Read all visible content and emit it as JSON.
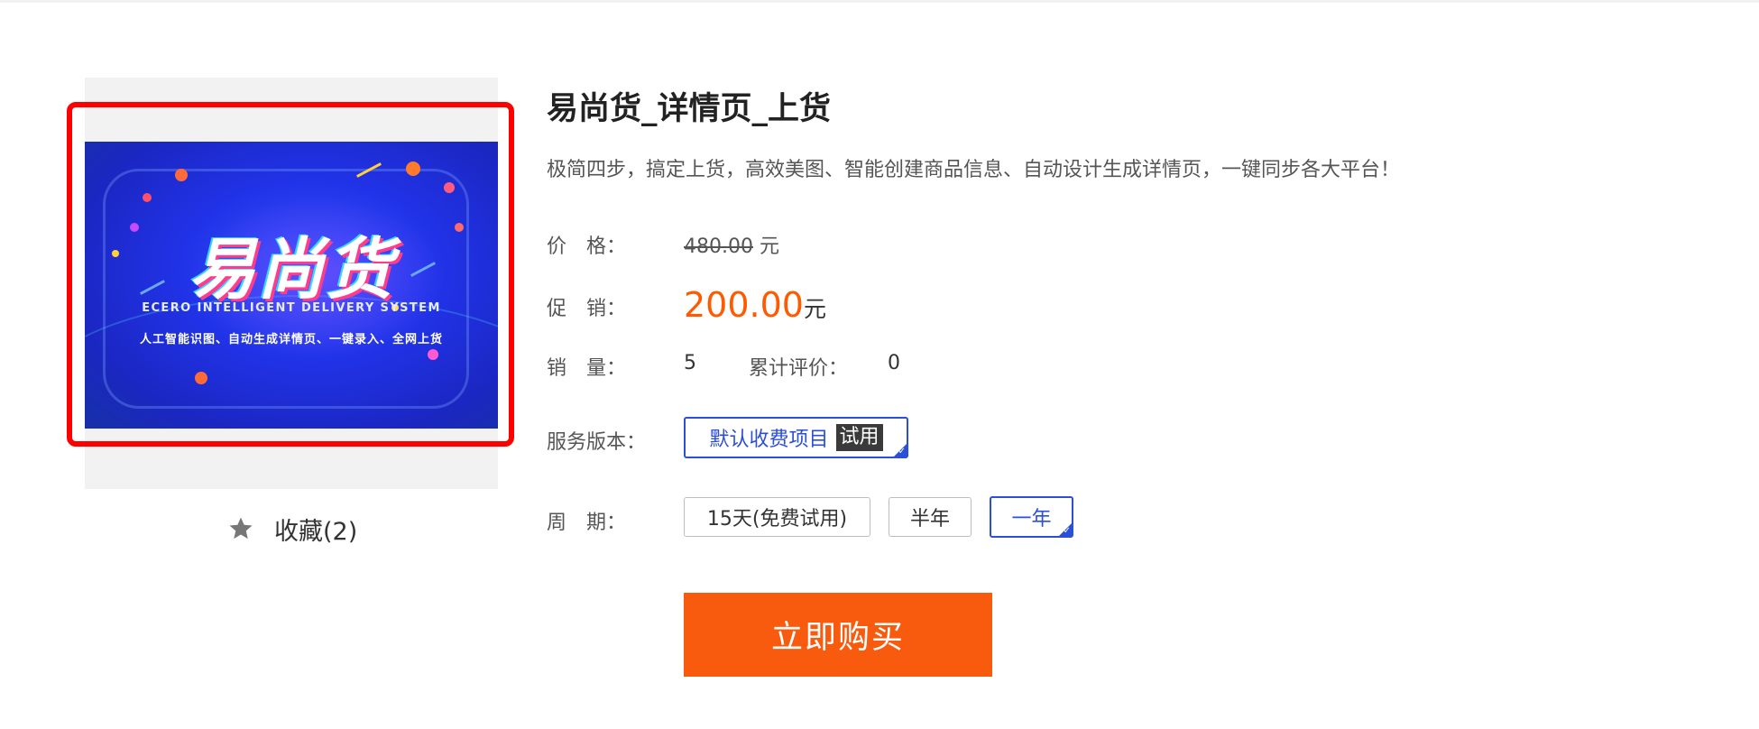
{
  "product": {
    "name": "易尚货_详情页_上货",
    "description": "极简四步，搞定上货，高效美图、智能创建商品信息、自动设计生成详情页，一键同步各大平台！"
  },
  "banner": {
    "brand_text": "易尚货",
    "english_subtitle": "ECERO INTELLIGENT DELIVERY SYSTEM",
    "tagline": "人工智能识图、自动生成详情页、一键录入、全网上货"
  },
  "favorite": {
    "label": "收藏(2)",
    "icon": "star-icon"
  },
  "price": {
    "label": "价　格：",
    "original_value": "480.00",
    "original_unit": "元",
    "promo_label": "促　销：",
    "promo_value": "200.00",
    "promo_unit": "元"
  },
  "stats": {
    "sales_label": "销　量：",
    "sales_value": "5",
    "reviews_label": "累计评价：",
    "reviews_value": "0"
  },
  "service": {
    "label": "服务版本：",
    "options": [
      {
        "label": "默认收费项目",
        "badge": "试用",
        "selected": true
      }
    ]
  },
  "period": {
    "label": "周　期：",
    "options": [
      {
        "label": "15天(免费试用)",
        "selected": false
      },
      {
        "label": "半年",
        "selected": false
      },
      {
        "label": "一年",
        "selected": true
      }
    ]
  },
  "buy_button": {
    "label": "立即购买"
  },
  "colors": {
    "accent": "#f85a0e",
    "promo_price": "#ff5a00",
    "selected_border": "#2b4fd6",
    "highlight_box": "#ff0000"
  }
}
